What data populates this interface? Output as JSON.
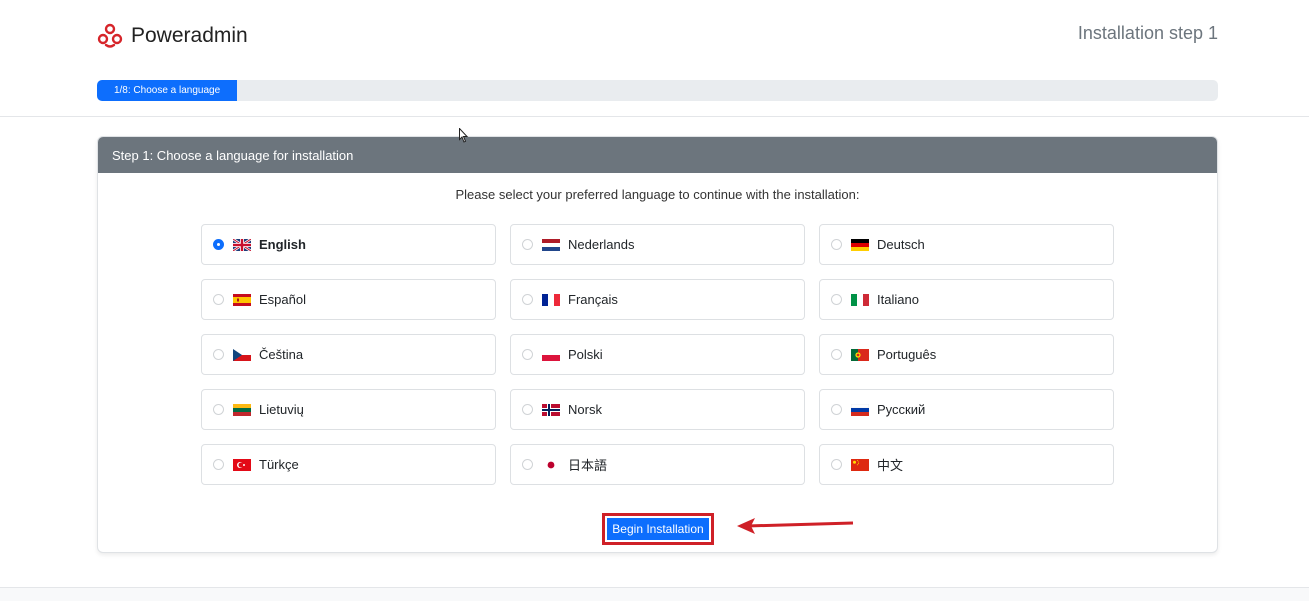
{
  "header": {
    "brand_name": "Poweradmin",
    "step_title": "Installation step 1",
    "progress": {
      "label": "1/8: Choose a language",
      "fraction": 0.125
    }
  },
  "card": {
    "title": "Step 1: Choose a language for installation",
    "intro": "Please select your preferred language to continue with the installation:",
    "languages": [
      {
        "label": "English",
        "selected": true,
        "flag_icon": "uk-flag-icon"
      },
      {
        "label": "Nederlands",
        "selected": false,
        "flag_icon": "netherlands-flag-icon"
      },
      {
        "label": "Deutsch",
        "selected": false,
        "flag_icon": "germany-flag-icon"
      },
      {
        "label": "Español",
        "selected": false,
        "flag_icon": "spain-flag-icon"
      },
      {
        "label": "Français",
        "selected": false,
        "flag_icon": "france-flag-icon"
      },
      {
        "label": "Italiano",
        "selected": false,
        "flag_icon": "italy-flag-icon"
      },
      {
        "label": "Čeština",
        "selected": false,
        "flag_icon": "czech-flag-icon"
      },
      {
        "label": "Polski",
        "selected": false,
        "flag_icon": "poland-flag-icon"
      },
      {
        "label": "Português",
        "selected": false,
        "flag_icon": "portugal-flag-icon"
      },
      {
        "label": "Lietuvių",
        "selected": false,
        "flag_icon": "lithuania-flag-icon"
      },
      {
        "label": "Norsk",
        "selected": false,
        "flag_icon": "norway-flag-icon"
      },
      {
        "label": "Русский",
        "selected": false,
        "flag_icon": "russia-flag-icon"
      },
      {
        "label": "Türkçe",
        "selected": false,
        "flag_icon": "turkey-flag-icon"
      },
      {
        "label": "日本語",
        "selected": false,
        "flag_icon": "japan-flag-icon"
      },
      {
        "label": "中文",
        "selected": false,
        "flag_icon": "china-flag-icon"
      }
    ],
    "submit_label": "Begin Installation"
  },
  "colors": {
    "primary": "#0d6efd",
    "card_header": "#6c757d",
    "annotation_red": "#cf2027",
    "logo_red": "#d6252a"
  }
}
